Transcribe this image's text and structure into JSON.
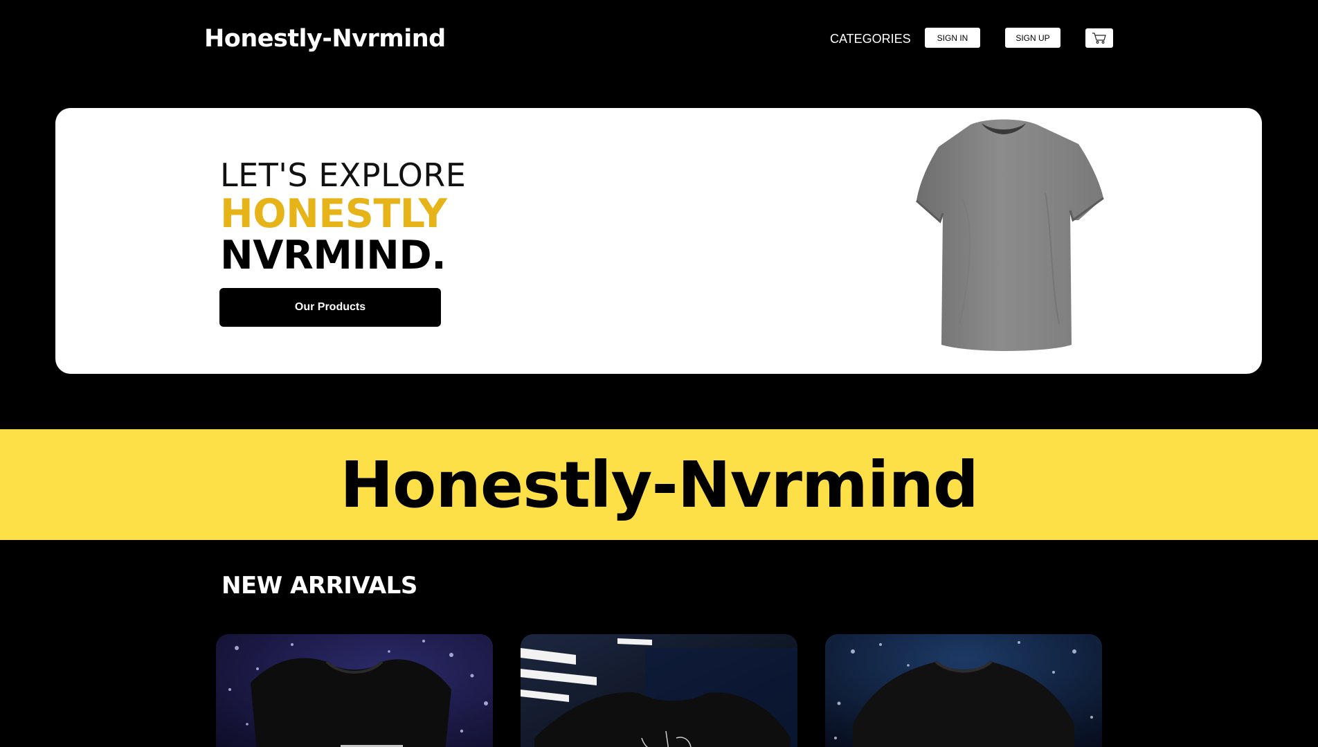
{
  "header": {
    "brand": "Honestly-Nvrmind",
    "nav": {
      "categories": "CATEGORIES",
      "sign_in": "SIGN IN",
      "sign_up": "SIGN UP",
      "cart_icon": "cart-icon"
    }
  },
  "hero": {
    "line1": "LET'S EXPLORE",
    "line2": "HONESTLY",
    "line3": "NVRMIND.",
    "cta": "Our Products",
    "image": "grey-tshirt"
  },
  "banner": {
    "title": "Honestly-Nvrmind"
  },
  "new_arrivals": {
    "title": "NEW ARRIVALS",
    "products": [
      {
        "image": "black-tshirt-bokeh-purple"
      },
      {
        "image": "black-tshirt-neon-lights"
      },
      {
        "image": "black-tshirt-bokeh-blue"
      }
    ]
  },
  "colors": {
    "page_bg": "#000000",
    "accent_yellow": "#e6b419",
    "banner_yellow": "#fde047",
    "card_bg": "#ffffff"
  }
}
